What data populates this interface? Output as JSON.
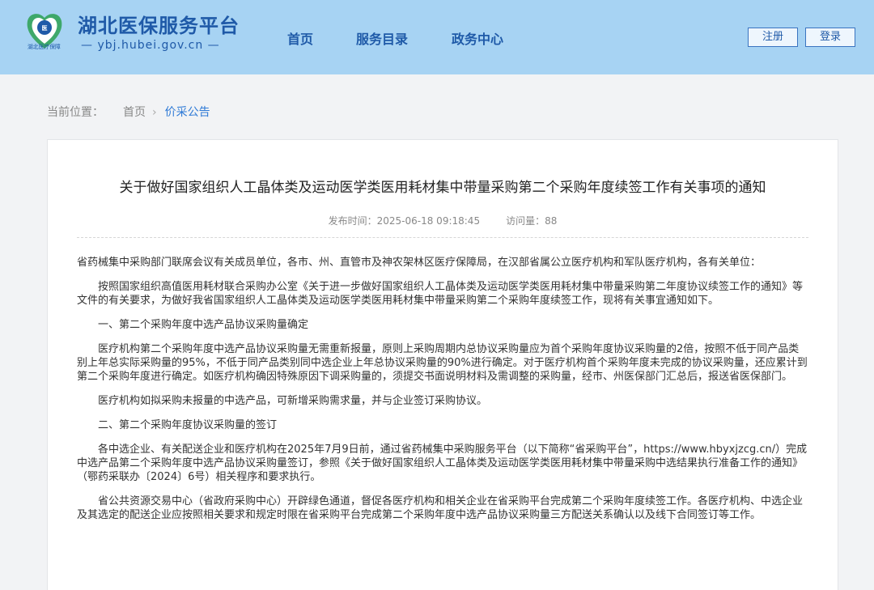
{
  "header": {
    "logo_text": "湖北医疗保障",
    "site_title": "湖北医保服务平台",
    "site_domain": "ybj.hubei.gov.cn",
    "nav": [
      "首页",
      "服务目录",
      "政务中心"
    ],
    "register_label": "注册",
    "login_label": "登录"
  },
  "breadcrumb": {
    "label": "当前位置：",
    "home": "首页",
    "current": "价采公告"
  },
  "article": {
    "title": "关于做好国家组织人工晶体类及运动医学类医用耗材集中带量采购第二个采购年度续签工作有关事项的通知",
    "publish_time": "发布时间：2025-06-18 09:18:45",
    "views": "访问量：88",
    "paragraphs": [
      "省药械集中采购部门联席会议有关成员单位，各市、州、直管市及神农架林区医疗保障局，在汉部省属公立医疗机构和军队医疗机构，各有关单位：",
      "按照国家组织高值医用耗材联合采购办公室《关于进一步做好国家组织人工晶体类及运动医学类医用耗材集中带量采购第二年度协议续签工作的通知》等文件的有关要求，为做好我省国家组织人工晶体类及运动医学类医用耗材集中带量采购第二个采购年度续签工作，现将有关事宜通知如下。",
      "一、第二个采购年度中选产品协议采购量确定",
      "医疗机构第二个采购年度中选产品协议采购量无需重新报量，原则上采购周期内总协议采购量应为首个采购年度协议采购量的2倍，按照不低于同产品类别上年总实际采购量的95%，不低于同产品类别同中选企业上年总协议采购量的90%进行确定。对于医疗机构首个采购年度未完成的协议采购量，还应累计到第二个采购年度进行确定。如医疗机构确因特殊原因下调采购量的，须提交书面说明材料及需调整的采购量，经市、州医保部门汇总后，报送省医保部门。",
      "医疗机构如拟采购未报量的中选产品，可新增采购需求量，并与企业签订采购协议。",
      "二、第二个采购年度协议采购量的签订",
      "各中选企业、有关配送企业和医疗机构在2025年7月9日前，通过省药械集中采购服务平台（以下简称“省采购平台”，https://www.hbyxjzcg.cn/）完成中选产品第二个采购年度中选产品协议采购量签订，参照《关于做好国家组织人工晶体类及运动医学类医用耗材集中带量采购中选结果执行准备工作的通知》（鄂药采联办〔2024〕6号）相关程序和要求执行。",
      "省公共资源交易中心（省政府采购中心）开辟绿色通道，督促各医疗机构和相关企业在省采购平台完成第二个采购年度续签工作。各医疗机构、中选企业及其选定的配送企业应按照相关要求和规定时限在省采购平台完成第二个采购年度中选产品协议采购量三方配送关系确认以及线下合同签订等工作。"
    ]
  }
}
